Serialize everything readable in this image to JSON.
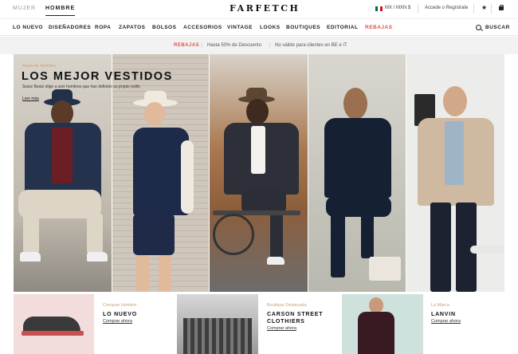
{
  "header": {
    "genders": [
      "MUJER",
      "HOMBRE"
    ],
    "active_gender": "HOMBRE",
    "logo": "FARFETCH",
    "currency": "MX / MXN $",
    "account": "Accede o Regístrate",
    "icons": [
      "mexico-flag-icon",
      "star-icon",
      "shopping-bag-icon"
    ]
  },
  "nav": {
    "items": [
      "LO NUEVO",
      "DISEÑADORES",
      "ROPA",
      "ZAPATOS",
      "BOLSOS",
      "ACCESORIOS",
      "VINTAGE",
      "LOOKS",
      "BOUTIQUES",
      "EDITORIAL",
      "REBAJAS"
    ],
    "search_label": "BUSCAR",
    "sale_color": "#d9534f"
  },
  "promo": {
    "sale": "REBAJAS",
    "discount": "Hasta 50% de Descuento",
    "note": "No válido para clientes en BE e IT"
  },
  "hero": {
    "tag": "Ropa de Hombre",
    "title": "LOS MEJOR VESTIDOS",
    "subtitle": "Swizz Beatz elige a seis hombres que han definido su propio estilo",
    "link": "Leer más"
  },
  "cards": [
    {
      "kicker": "Comprar Hombre",
      "title": "LO NUEVO",
      "link": "Comprar ahora"
    },
    {
      "kicker": "Boutique Destacada",
      "title": "CARSON STREET CLOTHIERS",
      "link": "Comprar ahora"
    },
    {
      "kicker": "La Marca",
      "title": "LANVIN",
      "link": "Comprar ahora"
    }
  ],
  "colors": {
    "accent_tan": "#c9a27a",
    "sale_red": "#d9534f"
  }
}
